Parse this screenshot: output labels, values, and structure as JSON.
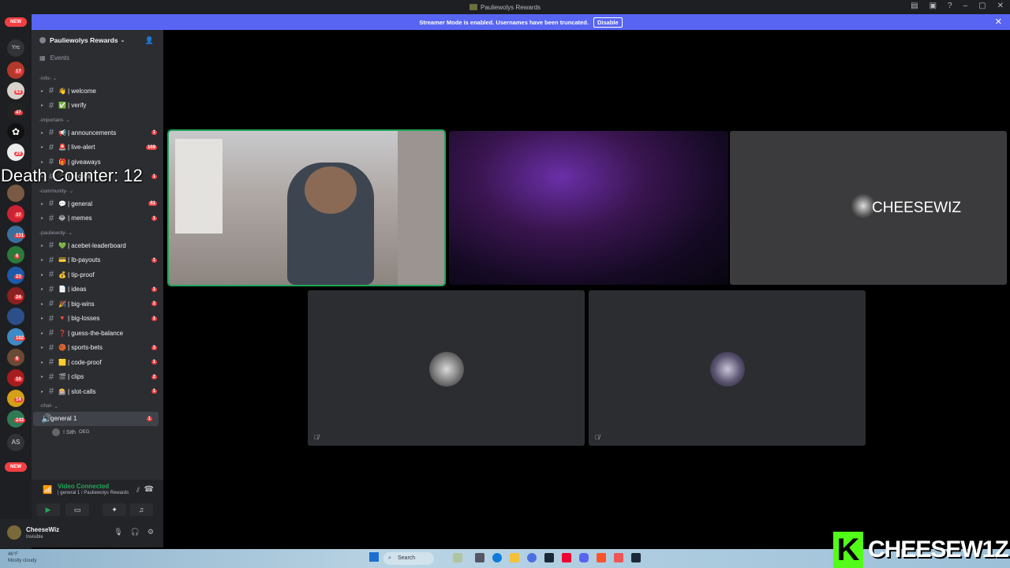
{
  "window": {
    "title": "Pauliewolys Rewards"
  },
  "streamer_banner": {
    "text": "Streamer Mode is enabled. Usernames have been truncated.",
    "button": "Disable"
  },
  "guild_rail": {
    "new_top": "NEW",
    "new_bottom": "NEW",
    "initials_top": "Yrc",
    "initials_bottom": "AS",
    "badges": [
      "17",
      "63",
      "47",
      "29",
      "37",
      "131",
      "6",
      "23",
      "24",
      "182",
      "6",
      "10",
      "14",
      "243"
    ]
  },
  "server": {
    "name": "Pauliewolys Rewards",
    "events": "Events"
  },
  "categories": {
    "info": "-info-",
    "important": "-important-",
    "community": "-community-",
    "pauliewoly": "-pauliewoly-",
    "chat": "-chat-"
  },
  "channels": {
    "info": [
      {
        "label": "| welcome",
        "emoji": "👋",
        "badge": ""
      },
      {
        "label": "| verify",
        "emoji": "✅",
        "badge": ""
      }
    ],
    "important": [
      {
        "label": "| announcements",
        "emoji": "📢",
        "badge": "1"
      },
      {
        "label": "| live-alert",
        "emoji": "🚨",
        "badge": "169"
      },
      {
        "label": "| giveaways",
        "emoji": "🎁",
        "badge": ""
      },
      {
        "label": "| socials",
        "emoji": "📱",
        "badge": "1"
      }
    ],
    "community": [
      {
        "label": "| general",
        "emoji": "💬",
        "badge": "81"
      },
      {
        "label": "| memes",
        "emoji": "😂",
        "badge": "1"
      }
    ],
    "pauliewoly": [
      {
        "label": "| acebet-leaderboard",
        "emoji": "💚",
        "badge": ""
      },
      {
        "label": "| lb-payouts",
        "emoji": "💳",
        "badge": "1"
      },
      {
        "label": "| tip-proof",
        "emoji": "💰",
        "badge": ""
      },
      {
        "label": "| ideas",
        "emoji": "📄",
        "badge": "1"
      },
      {
        "label": "| big-wins",
        "emoji": "🎉",
        "badge": "2"
      },
      {
        "label": "| big-losses",
        "emoji": "🔻",
        "badge": "1"
      },
      {
        "label": "| guess-the-balance",
        "emoji": "❓",
        "badge": ""
      },
      {
        "label": "| sports-bets",
        "emoji": "🏀",
        "badge": "3"
      },
      {
        "label": "| code-proof",
        "emoji": "🟨",
        "badge": "1"
      },
      {
        "label": "| clips",
        "emoji": "🎬",
        "badge": "2"
      },
      {
        "label": "| slot-calls",
        "emoji": "🎰",
        "badge": "1"
      }
    ],
    "voice": {
      "label": "general 1",
      "badge": "1"
    },
    "voice_user": {
      "name": "! Sith",
      "tag": "OEG"
    }
  },
  "overlay": {
    "death_counter": "Death Counter: 12"
  },
  "voice_panel": {
    "status": "Video Connected",
    "sub": "| general 1 / Pauliewolys Rewards"
  },
  "user_panel": {
    "name": "CheeseWiz",
    "status": "Invisible"
  },
  "tiles": {
    "cheesewiz_label": "CHEESEWIZ"
  },
  "taskbar": {
    "temp": "46°F",
    "weather": "Mostly cloudy",
    "search": "Search"
  },
  "watermark": {
    "k": "K",
    "text": "CHEESEW1Z"
  },
  "colors": {
    "accent": "#5865f2",
    "speaking": "#23a559",
    "badge": "#f23f43",
    "kick": "#53fc18"
  }
}
